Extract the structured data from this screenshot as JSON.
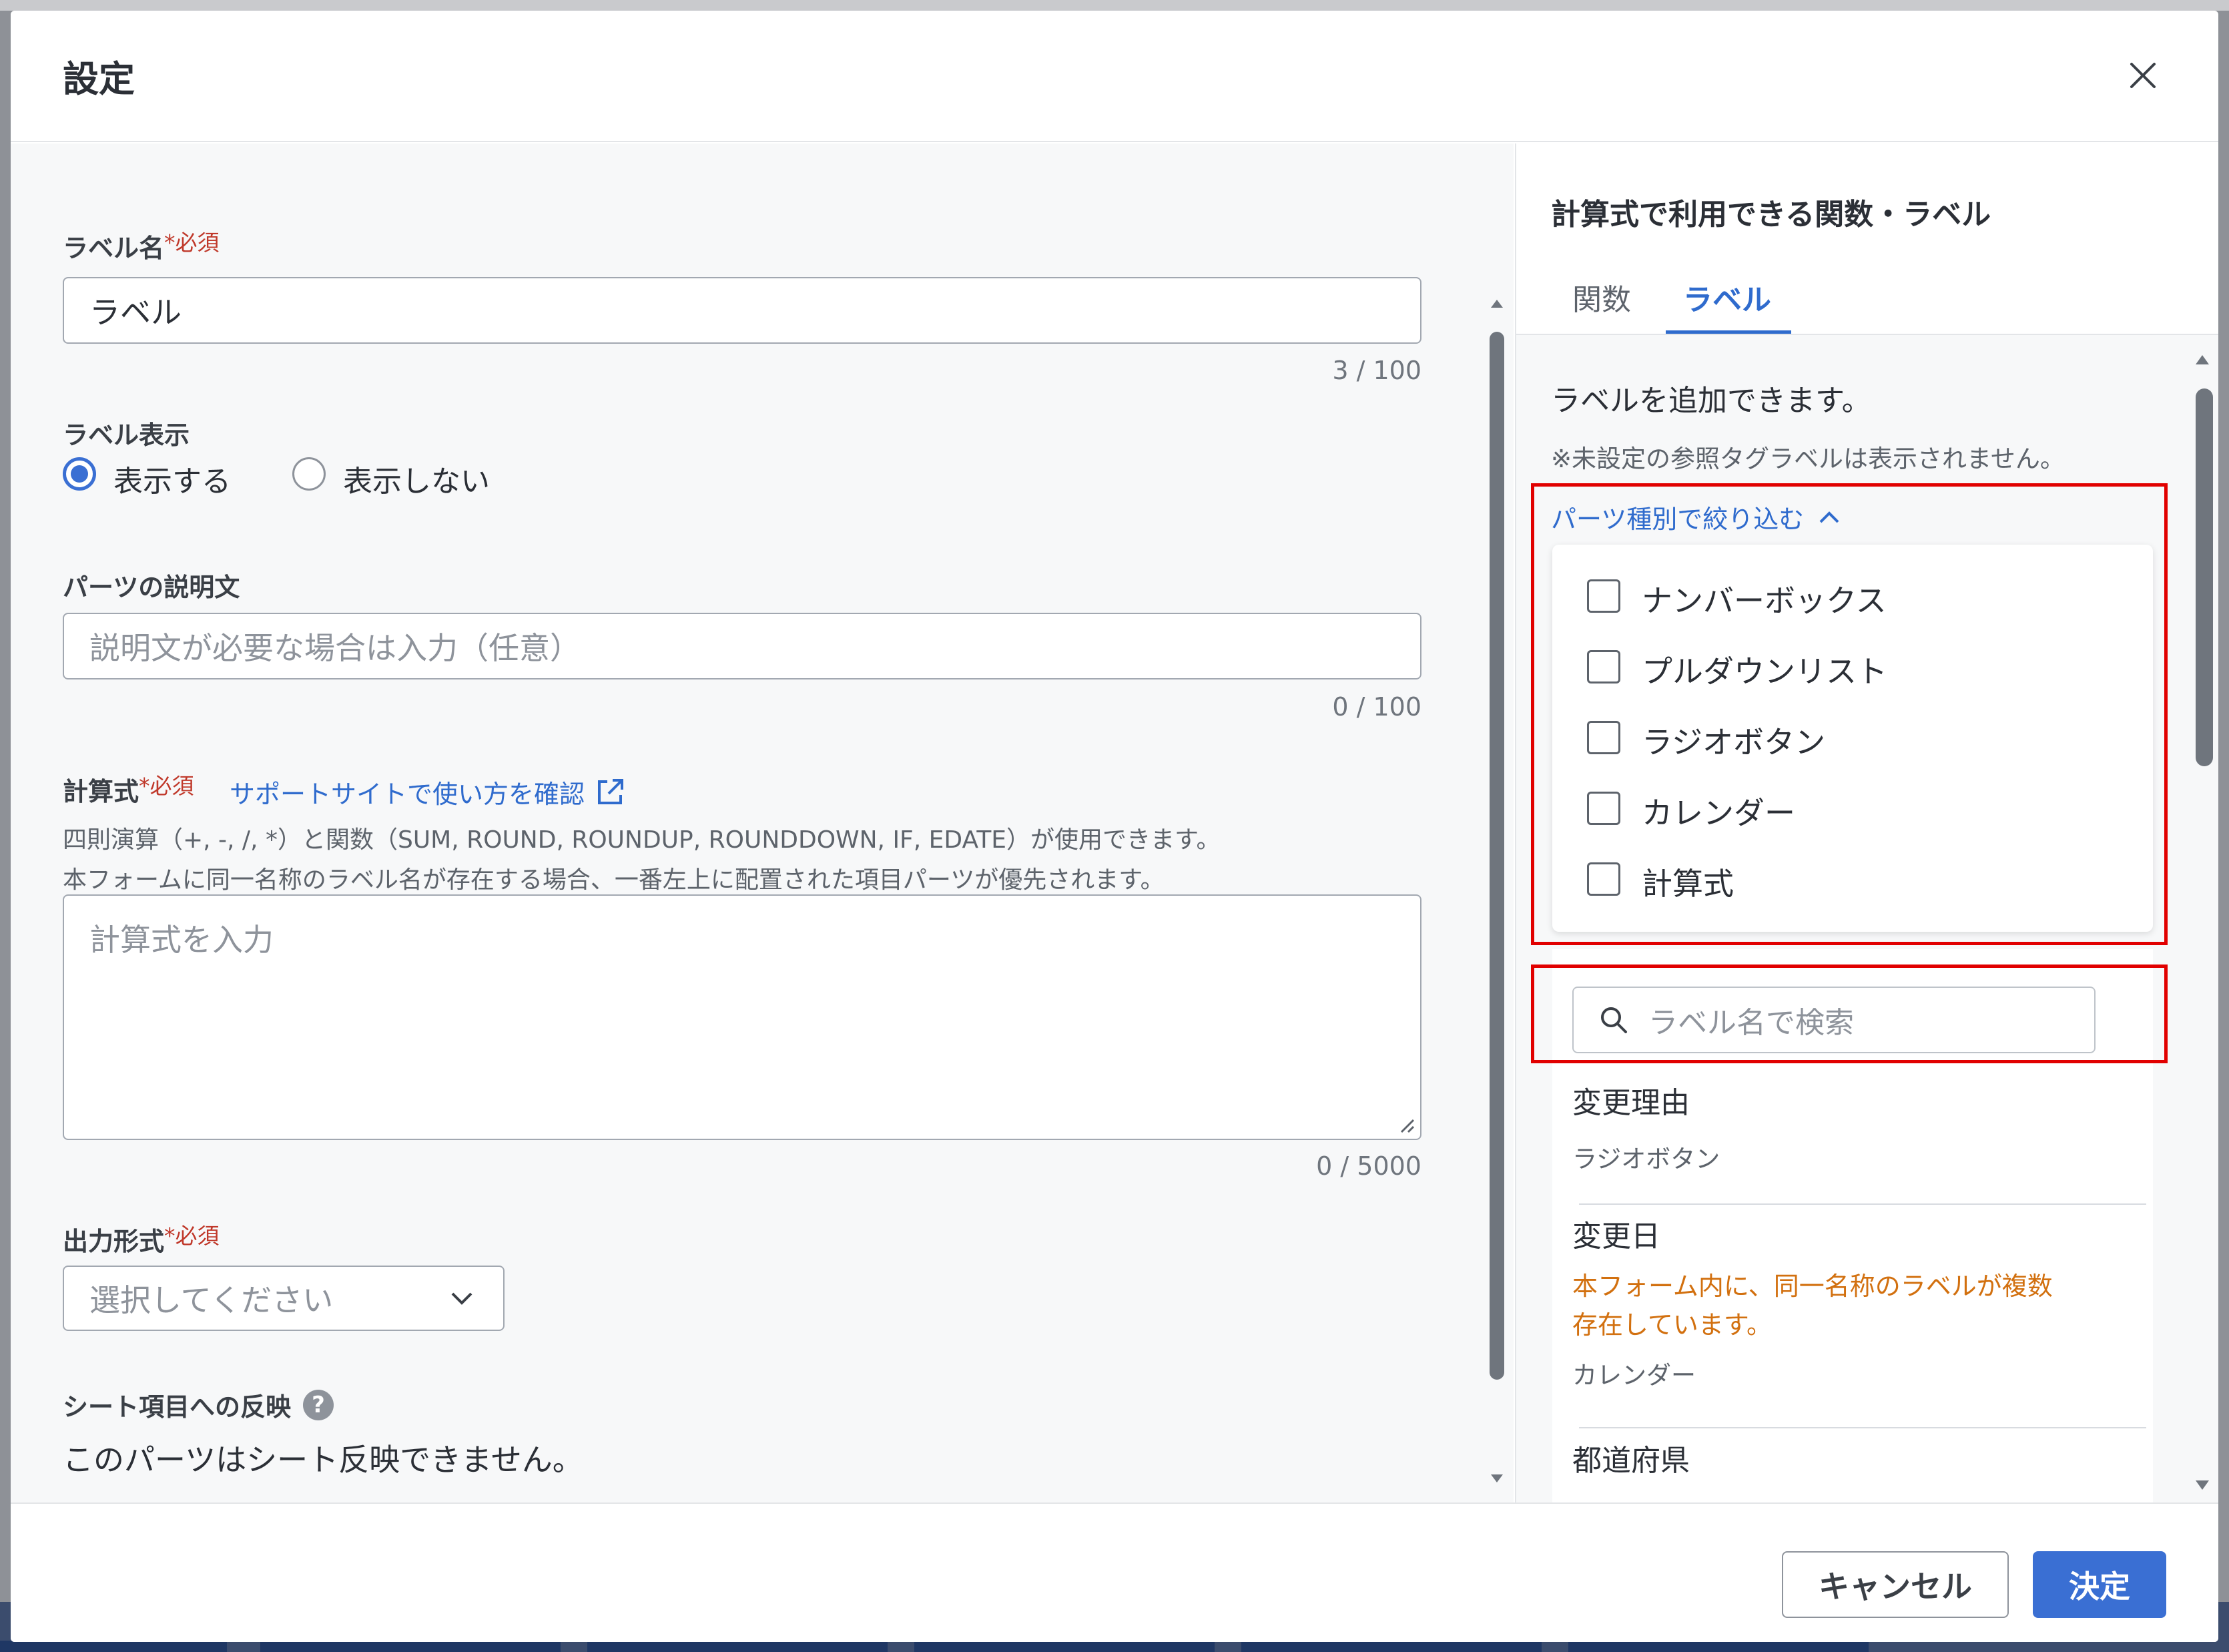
{
  "dialog": {
    "title": "設定",
    "close_icon": "close-icon"
  },
  "form": {
    "required_mark": "*必須",
    "label_name": {
      "label": "ラベル名",
      "value": "ラベル",
      "counter": "3 / 100"
    },
    "label_display": {
      "label": "ラベル表示",
      "options": [
        "表示する",
        "表示しない"
      ],
      "selected": "表示する"
    },
    "description": {
      "label": "パーツの説明文",
      "placeholder": "説明文が必要な場合は入力（任意）",
      "counter": "0 / 100"
    },
    "formula": {
      "label": "計算式",
      "support_link": "サポートサイトで使い方を確認",
      "help_line1": "四則演算（+, -, /, *）と関数（SUM, ROUND, ROUNDUP, ROUNDDOWN, IF, EDATE）が使用できます。",
      "help_line2": "本フォームに同一名称のラベル名が存在する場合、一番左上に配置された項目パーツが優先されます。",
      "placeholder": "計算式を入力",
      "counter": "0 / 5000"
    },
    "output_format": {
      "label": "出力形式",
      "placeholder": "選択してください"
    },
    "sheet": {
      "label": "シート項目への反映",
      "note": "このパーツはシート反映できません。"
    }
  },
  "side": {
    "title": "計算式で利用できる関数・ラベル",
    "tabs": [
      "関数",
      "ラベル"
    ],
    "active_tab": "ラベル",
    "intro": "ラベルを追加できます。",
    "note": "※未設定の参照タグラベルは表示されません。",
    "filter_toggle": "パーツ種別で絞り込む",
    "filters": [
      "ナンバーボックス",
      "プルダウンリスト",
      "ラジオボタン",
      "カレンダー",
      "計算式"
    ],
    "search_placeholder": "ラベル名で検索",
    "items": [
      {
        "name": "変更理由",
        "type": "ラジオボタン"
      },
      {
        "name": "変更日",
        "warning": [
          "本フォーム内に、同一名称のラベルが複数",
          "存在しています。"
        ],
        "type": "カレンダー"
      },
      {
        "name": "都道府県"
      }
    ]
  },
  "footer": {
    "cancel": "キャンセル",
    "ok": "決定"
  },
  "colors": {
    "accent": "#3a6fd3",
    "link": "#2f6bcd",
    "required": "#c0392b",
    "warning": "#d2700f",
    "highlight_box": "#e10000"
  }
}
